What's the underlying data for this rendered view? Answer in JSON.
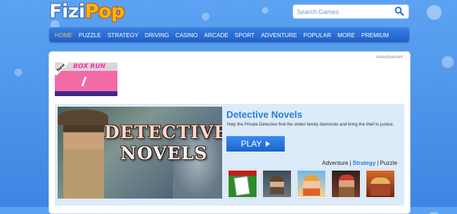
{
  "brand": {
    "part1": "Fizi",
    "part2": "Pop"
  },
  "search": {
    "placeholder": "Search Games"
  },
  "nav": {
    "items": [
      "HOME",
      "PUZZLE",
      "STRATEGY",
      "DRIVING",
      "CASINO",
      "ARCADE",
      "SPORT",
      "ADVENTURE",
      "POPULAR",
      "MORE",
      "PREMIUM"
    ],
    "active_index": 0
  },
  "ad_label": "Advertisement",
  "new_game": {
    "badge": "New",
    "title": "BOX RUN"
  },
  "featured": {
    "image_line1": "DETECTIVE",
    "image_line2": "NOVELS",
    "title": "Detective Novels",
    "description": "Help the Private Detective find the stolen family diamonds and bring the thief to justice.",
    "play_label": "PLAY",
    "categories": [
      "Adventure",
      "Strategy",
      "Puzzle"
    ],
    "highlighted_category": "Strategy",
    "related_count": 5
  },
  "colors": {
    "background": "#4f95ea",
    "nav": "#2a6fd6",
    "nav_active": "#ffbf54",
    "link_blue": "#2a7bd6",
    "feature_bg": "#dcebfa"
  }
}
